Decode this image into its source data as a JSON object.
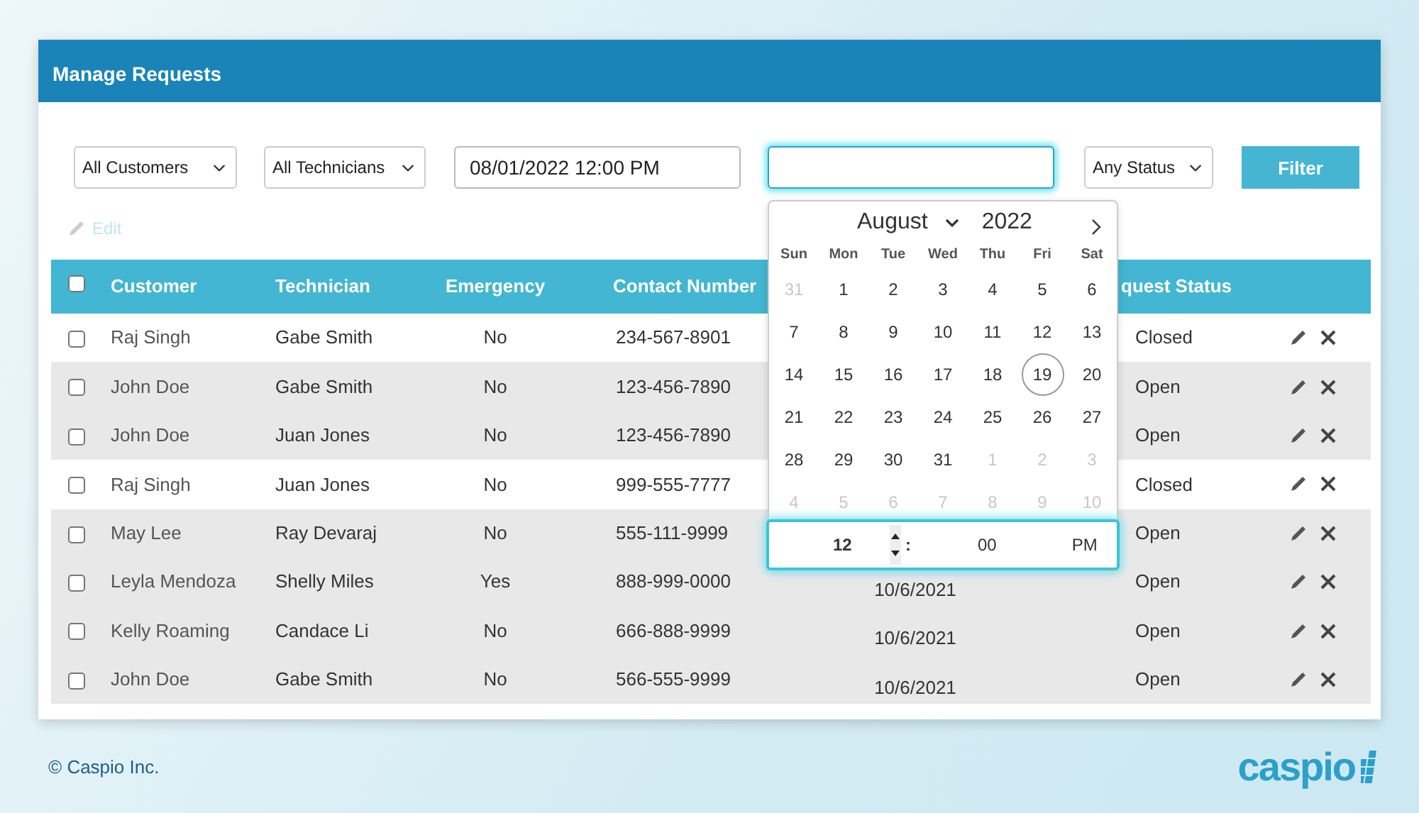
{
  "card": {
    "title": "Manage Requests"
  },
  "filters": {
    "customer": "All Customers",
    "technician": "All Technicians",
    "start_date": "08/01/2022 12:00 PM",
    "end_date": {
      "focused": true
    },
    "status": "Any Status",
    "button": "Filter"
  },
  "edit_link": {
    "label": "Edit",
    "disabled": true
  },
  "table": {
    "select_all": {
      "checked": false
    },
    "columns": [
      "Customer",
      "Technician",
      "Emergency",
      "Contact Number",
      "quest Status"
    ],
    "rows": [
      {
        "customer": "Raj Singh",
        "technician": "Gabe Smith",
        "emergency": "No",
        "contact": "234-567-8901",
        "status": "Closed",
        "checked": false,
        "shaded": false
      },
      {
        "customer": "John Doe",
        "technician": "Gabe Smith",
        "emergency": "No",
        "contact": "123-456-7890",
        "status": "Open",
        "checked": false,
        "shaded": true
      },
      {
        "customer": "John Doe",
        "technician": "Juan Jones",
        "emergency": "No",
        "contact": "123-456-7890",
        "status": "Open",
        "checked": false,
        "shaded": true
      },
      {
        "customer": "Raj Singh",
        "technician": "Juan Jones",
        "emergency": "No",
        "contact": "999-555-7777",
        "status": "Closed",
        "checked": false,
        "shaded": false
      },
      {
        "customer": "May Lee",
        "technician": "Ray Devaraj",
        "emergency": "No",
        "contact": "555-111-9999",
        "status": "Open",
        "checked": false,
        "shaded": true
      },
      {
        "customer": "Leyla Mendoza",
        "technician": "Shelly Miles",
        "emergency": "Yes",
        "contact": "888-999-0000",
        "date": "10/6/2021",
        "status": "Open",
        "checked": false,
        "shaded": true
      },
      {
        "customer": "Kelly Roaming",
        "technician": "Candace Li",
        "emergency": "No",
        "contact": "666-888-9999",
        "date": "10/6/2021",
        "status": "Open",
        "checked": false,
        "shaded": true
      },
      {
        "customer": "John Doe",
        "technician": "Gabe Smith",
        "emergency": "No",
        "contact": "566-555-9999",
        "date": "10/6/2021",
        "status": "Open",
        "checked": false,
        "shaded": true
      }
    ]
  },
  "calendar": {
    "month": "August",
    "year": "2022",
    "weekdays": [
      "Sun",
      "Mon",
      "Tue",
      "Wed",
      "Thu",
      "Fri",
      "Sat"
    ],
    "weeks": [
      [
        {
          "day": "31",
          "outside": true,
          "today": false
        },
        {
          "day": "1",
          "outside": false,
          "today": false
        },
        {
          "day": "2",
          "outside": false,
          "today": false
        },
        {
          "day": "3",
          "outside": false,
          "today": false
        },
        {
          "day": "4",
          "outside": false,
          "today": false
        },
        {
          "day": "5",
          "outside": false,
          "today": false
        },
        {
          "day": "6",
          "outside": false,
          "today": false
        }
      ],
      [
        {
          "day": "7",
          "outside": false,
          "today": false
        },
        {
          "day": "8",
          "outside": false,
          "today": false
        },
        {
          "day": "9",
          "outside": false,
          "today": false
        },
        {
          "day": "10",
          "outside": false,
          "today": false
        },
        {
          "day": "11",
          "outside": false,
          "today": false
        },
        {
          "day": "12",
          "outside": false,
          "today": false
        },
        {
          "day": "13",
          "outside": false,
          "today": false
        }
      ],
      [
        {
          "day": "14",
          "outside": false,
          "today": false
        },
        {
          "day": "15",
          "outside": false,
          "today": false
        },
        {
          "day": "16",
          "outside": false,
          "today": false
        },
        {
          "day": "17",
          "outside": false,
          "today": false
        },
        {
          "day": "18",
          "outside": false,
          "today": false
        },
        {
          "day": "19",
          "outside": false,
          "today": true
        },
        {
          "day": "20",
          "outside": false,
          "today": false
        }
      ],
      [
        {
          "day": "21",
          "outside": false,
          "today": false
        },
        {
          "day": "22",
          "outside": false,
          "today": false
        },
        {
          "day": "23",
          "outside": false,
          "today": false
        },
        {
          "day": "24",
          "outside": false,
          "today": false
        },
        {
          "day": "25",
          "outside": false,
          "today": false
        },
        {
          "day": "26",
          "outside": false,
          "today": false
        },
        {
          "day": "27",
          "outside": false,
          "today": false
        }
      ],
      [
        {
          "day": "28",
          "outside": false,
          "today": false
        },
        {
          "day": "29",
          "outside": false,
          "today": false
        },
        {
          "day": "30",
          "outside": false,
          "today": false
        },
        {
          "day": "31",
          "outside": false,
          "today": false
        },
        {
          "day": "1",
          "outside": true,
          "today": false
        },
        {
          "day": "2",
          "outside": true,
          "today": false
        },
        {
          "day": "3",
          "outside": true,
          "today": false
        }
      ],
      [
        {
          "day": "4",
          "outside": true,
          "today": false
        },
        {
          "day": "5",
          "outside": true,
          "today": false
        },
        {
          "day": "6",
          "outside": true,
          "today": false
        },
        {
          "day": "7",
          "outside": true,
          "today": false
        },
        {
          "day": "8",
          "outside": true,
          "today": false
        },
        {
          "day": "9",
          "outside": true,
          "today": false
        },
        {
          "day": "10",
          "outside": true,
          "today": false
        }
      ]
    ],
    "time": {
      "hour": "12",
      "separator": ":",
      "minute": "00",
      "period": "PM"
    }
  },
  "footer": {
    "copyright": "© Caspio Inc.",
    "logo": "caspio"
  }
}
